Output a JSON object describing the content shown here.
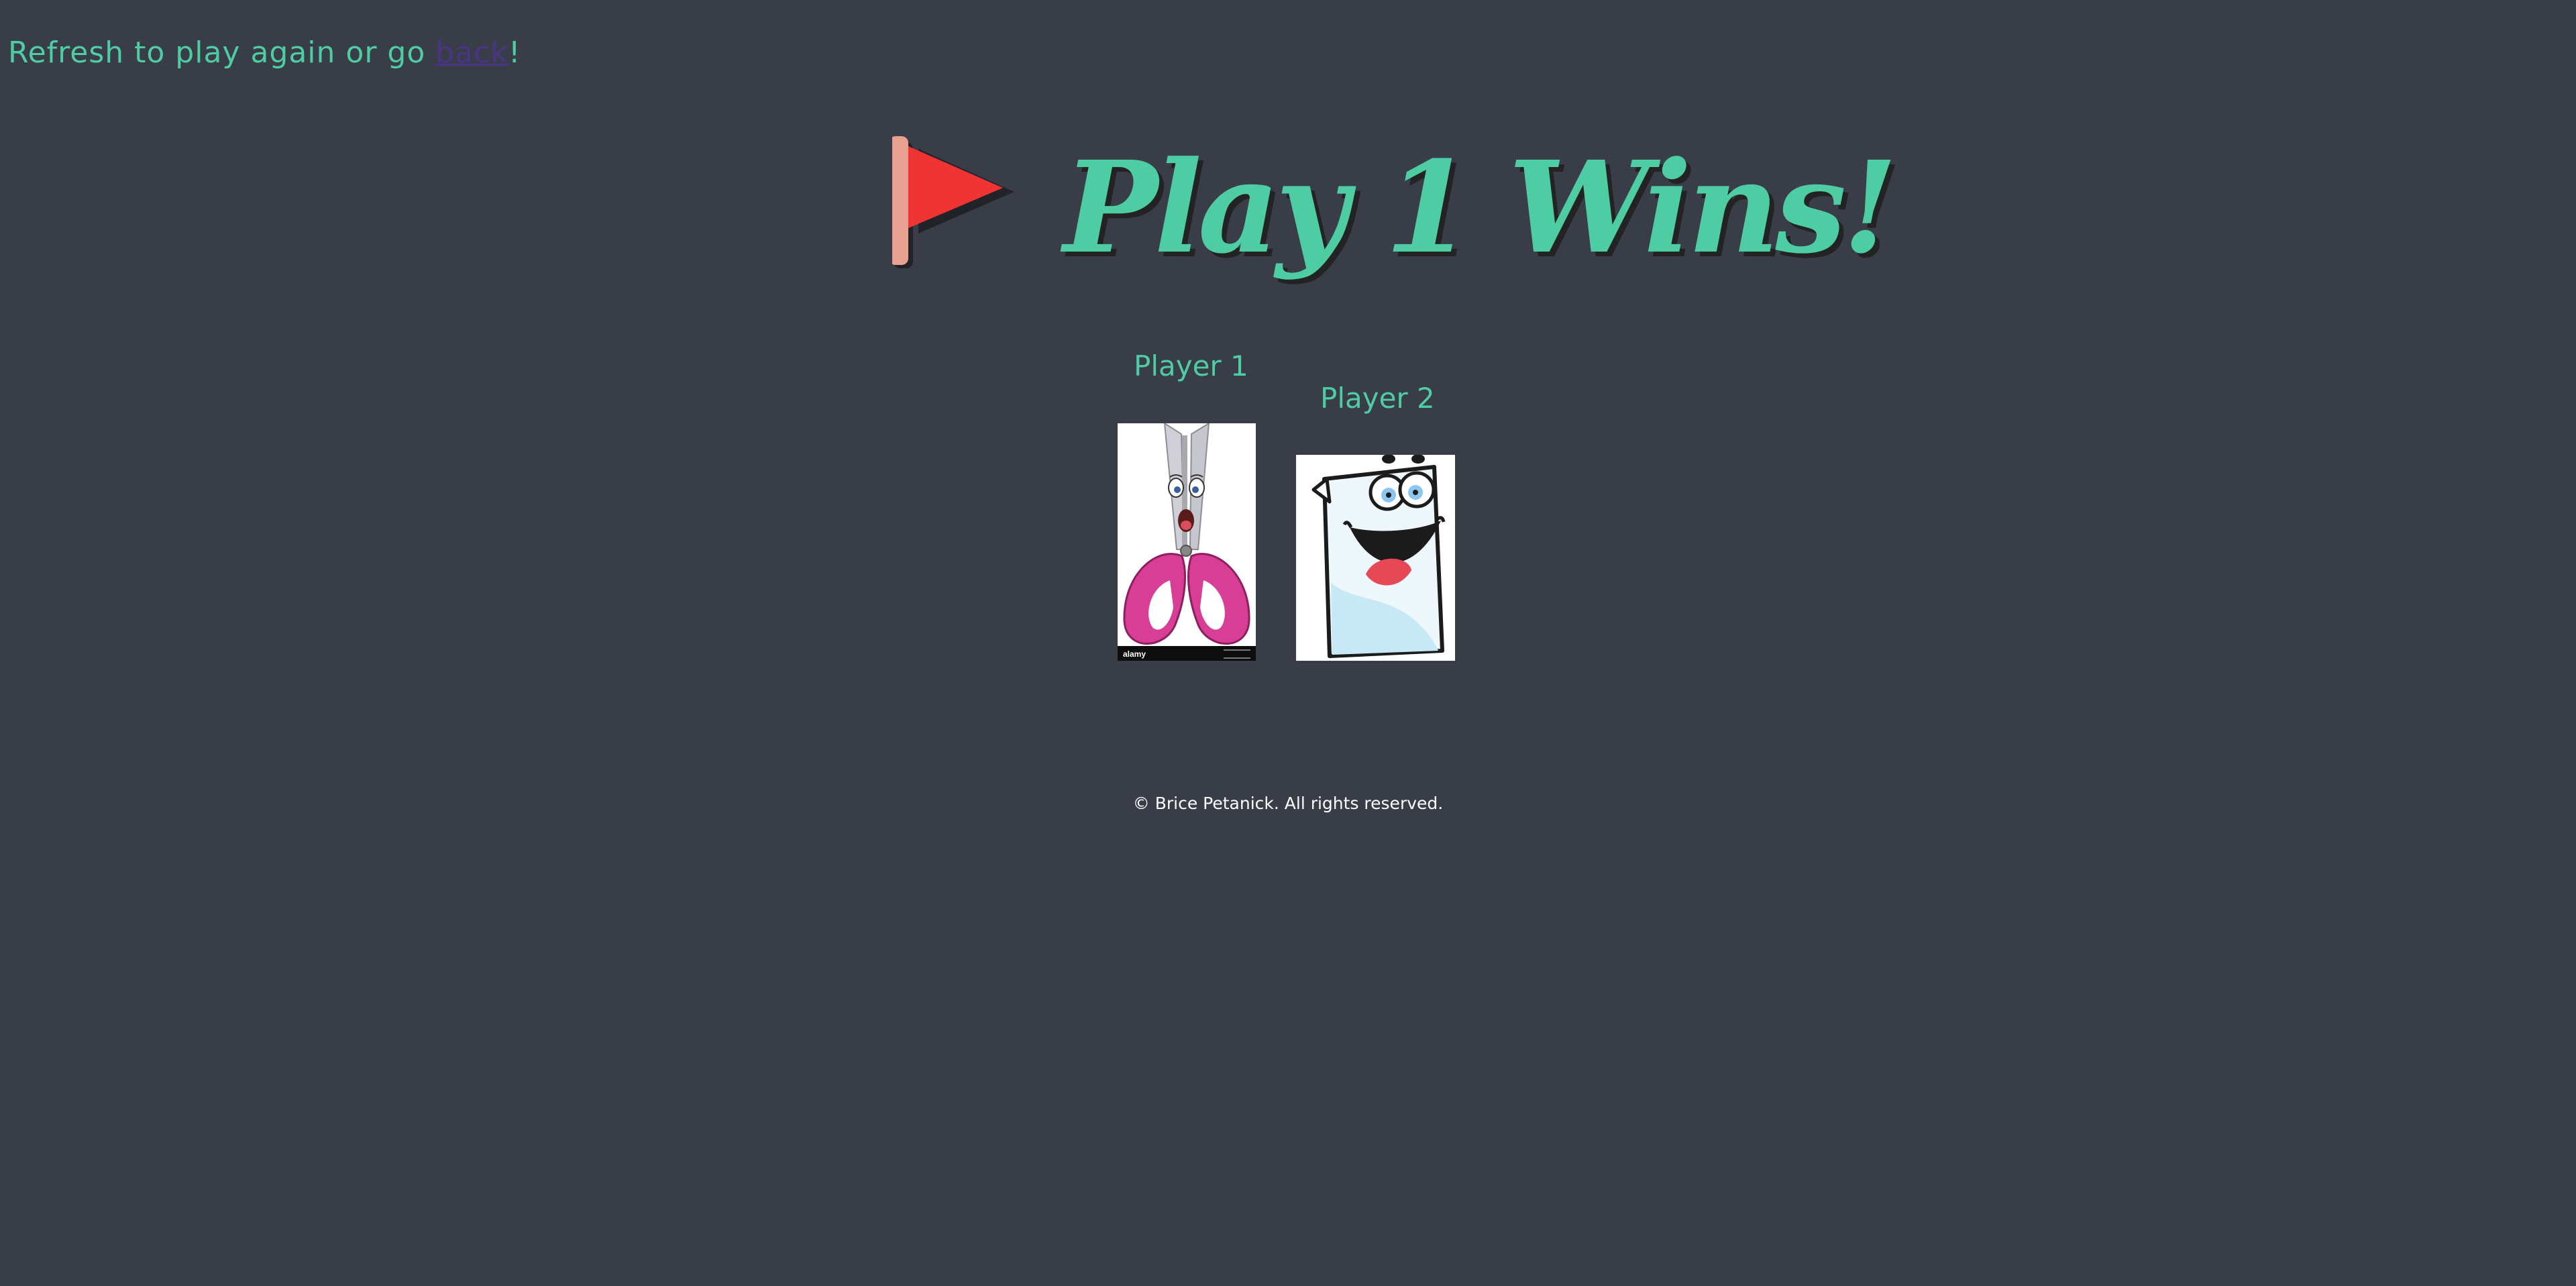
{
  "page": {
    "background_color": "#393d47",
    "accent_color": "#4ecca3"
  },
  "top_message": {
    "prefix": "Refresh to play again or go ",
    "link_text": "back",
    "suffix": "!",
    "link_color": "#4a3486"
  },
  "result": {
    "icon": "flag-icon",
    "headline": "Play 1 Wins!"
  },
  "players": [
    {
      "label": "Player 1",
      "choice_icon": "scissors-cartoon-icon",
      "stock_watermark": "alamy"
    },
    {
      "label": "Player 2",
      "choice_icon": "paper-cartoon-icon"
    }
  ],
  "footer": {
    "copyright": "© Brice Petanick. All rights reserved."
  }
}
